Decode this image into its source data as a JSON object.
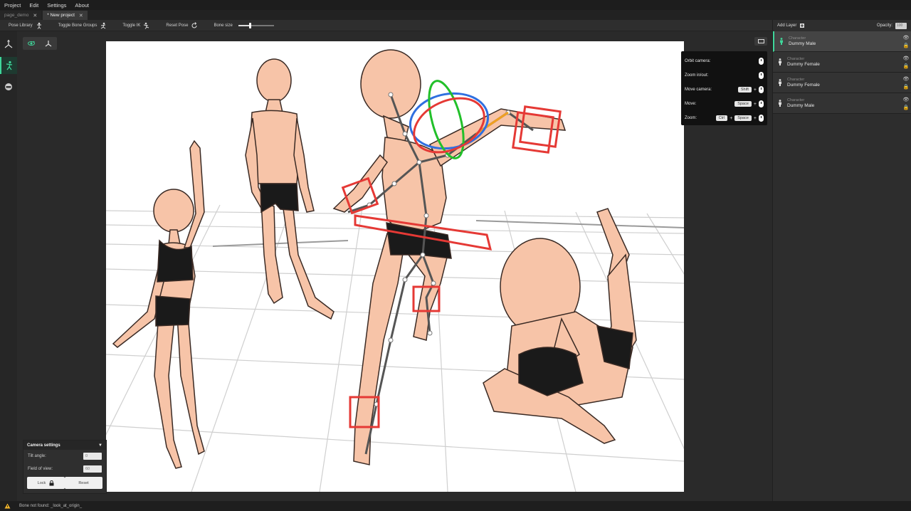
{
  "menu": [
    "Project",
    "Edit",
    "Settings",
    "About"
  ],
  "tabs": [
    {
      "label": "page_demo",
      "active": false
    },
    {
      "label": "* New project",
      "active": true
    }
  ],
  "toolbar": {
    "pose_library": "Pose Library",
    "toggle_bone_groups": "Toggle Bone Groups",
    "toggle_ik": "Toggle IK",
    "reset_pose": "Reset Pose",
    "bone_size": "Bone size",
    "bone_size_value": 0.35
  },
  "controls_help": [
    {
      "label": "Orbit camera:",
      "keys": []
    },
    {
      "label": "Zoom in/out:",
      "keys": []
    },
    {
      "label": "Move camera:",
      "keys": [
        "Shift"
      ]
    },
    {
      "label": "Move:",
      "keys": [
        "Space"
      ]
    },
    {
      "label": "Zoom:",
      "keys": [
        "Ctrl",
        "Space"
      ]
    }
  ],
  "camera_settings": {
    "title": "Camera settings",
    "tilt_label": "Tilt angle:",
    "tilt_value": "0",
    "fov_label": "Field of view:",
    "fov_value": "60",
    "lock_label": "Lock",
    "reset_label": "Reset"
  },
  "right_panel": {
    "add_layer": "Add Layer",
    "opacity_label": "Opacity:",
    "opacity_value": "100",
    "layers": [
      {
        "type": "Character",
        "name": "Dummy Male",
        "active": true
      },
      {
        "type": "Character",
        "name": "Dummy Female",
        "active": false
      },
      {
        "type": "Character",
        "name": "Dummy Female",
        "active": false
      },
      {
        "type": "Character",
        "name": "Dummy Male",
        "active": false
      }
    ]
  },
  "status": {
    "message": "Bone not found: _look_at_origin_"
  },
  "colors": {
    "accent": "#3fd69a",
    "skin": "#f7c4a8",
    "gizmo_red": "#e53935"
  }
}
